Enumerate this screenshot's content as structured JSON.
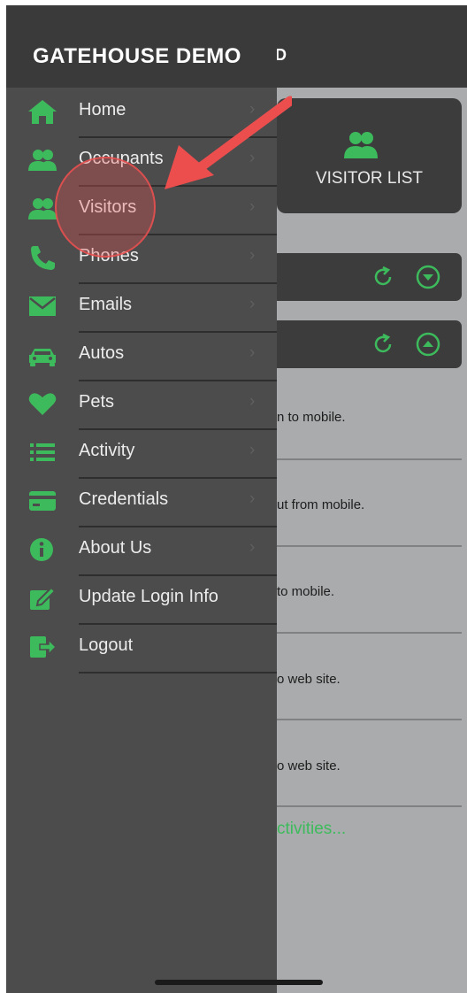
{
  "app": {
    "title": "GATEHOUSE DEMO",
    "header_partial": "RD"
  },
  "page": {
    "tile": {
      "label": "VISITOR LIST",
      "icon": "users-icon"
    },
    "bars": [
      {
        "icons": [
          "refresh-icon",
          "chevron-down-circle-icon"
        ]
      },
      {
        "icons": [
          "refresh-icon",
          "chevron-up-circle-icon"
        ]
      }
    ],
    "activity": [
      {
        "text": "n to mobile."
      },
      {
        "text": "ut from mobile."
      },
      {
        "text": " to mobile."
      },
      {
        "text": "o web site."
      },
      {
        "text": "o web site."
      }
    ],
    "more_link": "ctivities..."
  },
  "menu": {
    "items": [
      {
        "label": "Home",
        "icon": "home-icon",
        "chevron": "›"
      },
      {
        "label": "Occupants",
        "icon": "users-icon",
        "chevron": "›"
      },
      {
        "label": "Visitors",
        "icon": "users-icon",
        "chevron": "›"
      },
      {
        "label": "Phones",
        "icon": "phone-icon",
        "chevron": "›"
      },
      {
        "label": "Emails",
        "icon": "envelope-icon",
        "chevron": "›"
      },
      {
        "label": "Autos",
        "icon": "car-icon",
        "chevron": "›"
      },
      {
        "label": "Pets",
        "icon": "heart-icon",
        "chevron": "›"
      },
      {
        "label": "Activity",
        "icon": "list-icon",
        "chevron": "›"
      },
      {
        "label": "Credentials",
        "icon": "credit-card-icon",
        "chevron": "›"
      },
      {
        "label": "About Us",
        "icon": "info-icon",
        "chevron": "›"
      },
      {
        "label": "Update Login Info",
        "icon": "edit-icon",
        "chevron": ""
      },
      {
        "label": "Logout",
        "icon": "logout-icon",
        "chevron": ""
      }
    ]
  },
  "colors": {
    "accent": "#3dbb5c",
    "drawer": "#4c4c4d",
    "header": "#3a3a3b",
    "annotation": "#e84d4d"
  }
}
